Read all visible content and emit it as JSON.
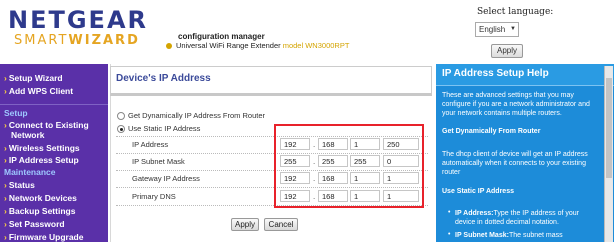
{
  "header": {
    "brand_top": "NETGEAR",
    "brand_bottom_a": "SMART",
    "brand_bottom_b": "WIZARD",
    "config": "configuration manager",
    "product_prefix": "Universal WiFi Range Extender",
    "product_model": "model WN3000RPT",
    "lang_label": "Select language:",
    "lang_value": "English",
    "lang_apply": "Apply"
  },
  "sidebar": {
    "top_items": [
      {
        "label": "Setup Wizard"
      },
      {
        "label": "Add WPS Client"
      }
    ],
    "setup_section": "Setup",
    "setup_items": [
      {
        "label": "Connect to Existing"
      },
      {
        "label": "Network"
      },
      {
        "label": "Wireless Settings"
      },
      {
        "label": "IP Address Setup"
      }
    ],
    "maint_section": "Maintenance",
    "maint_items": [
      {
        "label": "Status"
      },
      {
        "label": "Network Devices"
      },
      {
        "label": "Backup Settings"
      },
      {
        "label": "Set Password"
      },
      {
        "label": "Firmware Upgrade"
      }
    ]
  },
  "main": {
    "title": "Device's IP Address",
    "option_dynamic": "Get Dynamically IP Address From Router",
    "option_static": "Use Static IP Address",
    "fields": [
      {
        "label": "IP Address",
        "octets": [
          "192",
          "168",
          "1",
          "250"
        ]
      },
      {
        "label": "IP Subnet Mask",
        "octets": [
          "255",
          "255",
          "255",
          "0"
        ]
      },
      {
        "label": "Gateway IP Address",
        "octets": [
          "192",
          "168",
          "1",
          "1"
        ]
      },
      {
        "label": "Primary DNS",
        "octets": [
          "192",
          "168",
          "1",
          "1"
        ]
      }
    ],
    "apply": "Apply",
    "cancel": "Cancel"
  },
  "help": {
    "title": "IP Address Setup Help",
    "intro": "These are advanced settings that you may configure if you are a network administrator and your network contains multiple routers.",
    "dynamic_head": "Get Dynamically From Router",
    "dynamic_text": "The dhcp client of device will get an IP address automatically when it connects to your existing router",
    "static_head": "Use Static IP Address",
    "b1_head": "IP Address:",
    "b1_text": "Type the IP address of your device in dotted decimal notation.",
    "b2_head": "IP Subnet Mask:",
    "b2_text": "The subnet mass"
  },
  "colors": {
    "sidebar": "#5a30a8",
    "help": "#1d8cd9",
    "highlight": "#e8222b",
    "brand": "#2e3a8c"
  }
}
